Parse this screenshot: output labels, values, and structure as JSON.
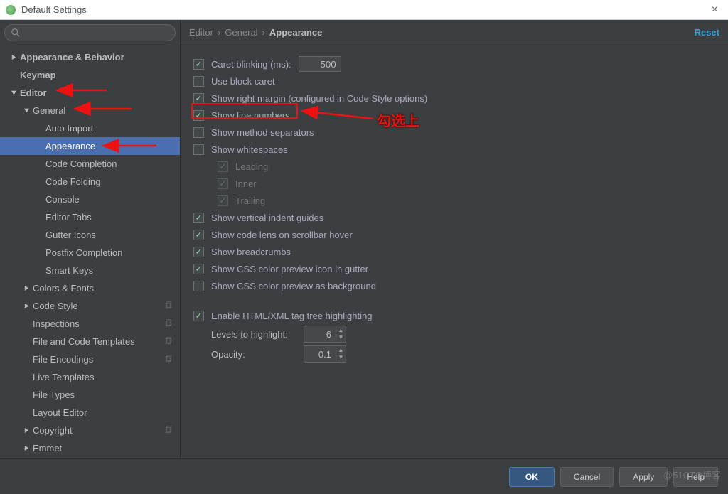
{
  "window": {
    "title": "Default Settings"
  },
  "sidebar": {
    "items": [
      {
        "label": "Appearance & Behavior",
        "depth": 0,
        "arrow": "right",
        "bold": true
      },
      {
        "label": "Keymap",
        "depth": 0,
        "arrow": "none",
        "bold": true
      },
      {
        "label": "Editor",
        "depth": 0,
        "arrow": "down",
        "bold": true
      },
      {
        "label": "General",
        "depth": 1,
        "arrow": "down"
      },
      {
        "label": "Auto Import",
        "depth": 2,
        "arrow": "none"
      },
      {
        "label": "Appearance",
        "depth": 2,
        "arrow": "none",
        "selected": true
      },
      {
        "label": "Code Completion",
        "depth": 2,
        "arrow": "none"
      },
      {
        "label": "Code Folding",
        "depth": 2,
        "arrow": "none"
      },
      {
        "label": "Console",
        "depth": 2,
        "arrow": "none"
      },
      {
        "label": "Editor Tabs",
        "depth": 2,
        "arrow": "none"
      },
      {
        "label": "Gutter Icons",
        "depth": 2,
        "arrow": "none"
      },
      {
        "label": "Postfix Completion",
        "depth": 2,
        "arrow": "none"
      },
      {
        "label": "Smart Keys",
        "depth": 2,
        "arrow": "none"
      },
      {
        "label": "Colors & Fonts",
        "depth": 1,
        "arrow": "right"
      },
      {
        "label": "Code Style",
        "depth": 1,
        "arrow": "right",
        "copy": true
      },
      {
        "label": "Inspections",
        "depth": 1,
        "arrow": "none",
        "copy": true
      },
      {
        "label": "File and Code Templates",
        "depth": 1,
        "arrow": "none",
        "copy": true
      },
      {
        "label": "File Encodings",
        "depth": 1,
        "arrow": "none",
        "copy": true
      },
      {
        "label": "Live Templates",
        "depth": 1,
        "arrow": "none"
      },
      {
        "label": "File Types",
        "depth": 1,
        "arrow": "none"
      },
      {
        "label": "Layout Editor",
        "depth": 1,
        "arrow": "none"
      },
      {
        "label": "Copyright",
        "depth": 1,
        "arrow": "right",
        "copy": true
      },
      {
        "label": "Emmet",
        "depth": 1,
        "arrow": "right"
      }
    ]
  },
  "breadcrumb": {
    "a": "Editor",
    "b": "General",
    "c": "Appearance"
  },
  "reset": "Reset",
  "opts": {
    "caret_blink": {
      "label": "Caret blinking (ms):",
      "value": "500",
      "checked": true
    },
    "block_caret": {
      "label": "Use block caret",
      "checked": false
    },
    "right_margin": {
      "label": "Show right margin (configured in Code Style options)",
      "checked": true
    },
    "line_numbers": {
      "label": "Show line numbers",
      "checked": true
    },
    "method_sep": {
      "label": "Show method separators",
      "checked": false
    },
    "whitespace": {
      "label": "Show whitespaces",
      "checked": false
    },
    "ws_leading": {
      "label": "Leading",
      "checked": true
    },
    "ws_inner": {
      "label": "Inner",
      "checked": true
    },
    "ws_trailing": {
      "label": "Trailing",
      "checked": true
    },
    "vguides": {
      "label": "Show vertical indent guides",
      "checked": true
    },
    "codelens": {
      "label": "Show code lens on scrollbar hover",
      "checked": true
    },
    "breadcrumbs": {
      "label": "Show breadcrumbs",
      "checked": true
    },
    "css_gutter": {
      "label": "Show CSS color preview icon in gutter",
      "checked": true
    },
    "css_bg": {
      "label": "Show CSS color preview as background",
      "checked": false
    },
    "xml_tree": {
      "label": "Enable HTML/XML tag tree highlighting",
      "checked": true
    },
    "levels": {
      "label": "Levels to highlight:",
      "value": "6"
    },
    "opacity": {
      "label": "Opacity:",
      "value": "0.1"
    }
  },
  "footer": {
    "ok": "OK",
    "cancel": "Cancel",
    "apply": "Apply",
    "help": "Help"
  },
  "annotation": {
    "text": "勾选上"
  },
  "watermark": "@51CTO博客"
}
